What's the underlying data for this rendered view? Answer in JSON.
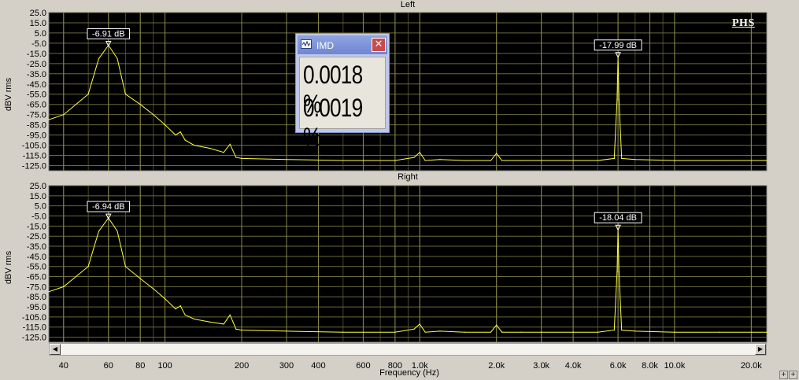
{
  "window": {
    "left_title": "Left",
    "right_title": "Right",
    "y_label": "dBV rms",
    "x_label": "Frequency (Hz)",
    "logo": "PHS"
  },
  "imd_dialog": {
    "title": "IMD",
    "close": "✕",
    "value_left": "0.0018 %",
    "value_right": "0.0019 %"
  },
  "scrollbar": {
    "left_arrow": "◀",
    "right_arrow": "▶"
  },
  "zoom_buttons": [
    "+",
    "+"
  ],
  "chart_data": [
    {
      "type": "line",
      "title": "Left",
      "ylabel": "dBV rms",
      "xlabel": "Frequency (Hz)",
      "xscale": "log",
      "xlim": [
        35,
        23000
      ],
      "ylim": [
        -130,
        25
      ],
      "yticks": [
        25,
        15,
        5,
        -5,
        -15,
        -25,
        -35,
        -45,
        -55,
        -65,
        -75,
        -85,
        -95,
        -105,
        -115,
        -125
      ],
      "xticks": [
        40,
        60,
        80,
        100,
        200,
        300,
        400,
        600,
        800,
        1000,
        2000,
        3000,
        4000,
        6000,
        8000,
        10000,
        20000
      ],
      "xtick_labels": [
        "40",
        "60",
        "80",
        "100",
        "200",
        "300",
        "400",
        "600",
        "800",
        "1.0k",
        "2.0k",
        "3.0k",
        "4.0k",
        "6.0k",
        "8.0k",
        "10.0k",
        "20.0k"
      ],
      "grid": true,
      "series": [
        {
          "color": "#ffff40",
          "x": [
            35,
            40,
            50,
            55,
            60,
            65,
            70,
            80,
            90,
            100,
            110,
            115,
            120,
            130,
            150,
            170,
            180,
            190,
            200,
            300,
            500,
            800,
            950,
            1000,
            1050,
            1200,
            1500,
            1900,
            2000,
            2100,
            2500,
            3000,
            4000,
            5000,
            5800,
            5950,
            6000,
            6050,
            6200,
            7000,
            10000,
            15000,
            23000
          ],
          "y": [
            -80,
            -75,
            -55,
            -20,
            -7,
            -20,
            -55,
            -65,
            -75,
            -85,
            -95,
            -92,
            -100,
            -105,
            -108,
            -112,
            -104,
            -117,
            -118,
            -119,
            -120,
            -120,
            -117,
            -112,
            -120,
            -119,
            -120,
            -120,
            -113,
            -120,
            -120,
            -120,
            -120,
            -120,
            -118,
            -60,
            -18,
            -60,
            -118,
            -119,
            -120,
            -120,
            -120
          ]
        }
      ],
      "annotations": [
        {
          "text": "-6.91 dB",
          "x": 60,
          "y": -7
        },
        {
          "text": "-17.99 dB",
          "x": 6000,
          "y": -18
        }
      ]
    },
    {
      "type": "line",
      "title": "Right",
      "ylabel": "dBV rms",
      "xlabel": "Frequency (Hz)",
      "xscale": "log",
      "xlim": [
        35,
        23000
      ],
      "ylim": [
        -130,
        25
      ],
      "yticks": [
        25,
        15,
        5,
        -5,
        -15,
        -25,
        -35,
        -45,
        -55,
        -65,
        -75,
        -85,
        -95,
        -105,
        -115,
        -125
      ],
      "xticks": [
        40,
        60,
        80,
        100,
        200,
        300,
        400,
        600,
        800,
        1000,
        2000,
        3000,
        4000,
        6000,
        8000,
        10000,
        20000
      ],
      "xtick_labels": [
        "40",
        "60",
        "80",
        "100",
        "200",
        "300",
        "400",
        "600",
        "800",
        "1.0k",
        "2.0k",
        "3.0k",
        "4.0k",
        "6.0k",
        "8.0k",
        "10.0k",
        "20.0k"
      ],
      "grid": true,
      "series": [
        {
          "color": "#ffff40",
          "x": [
            35,
            40,
            50,
            55,
            60,
            65,
            70,
            80,
            90,
            100,
            110,
            115,
            120,
            130,
            150,
            170,
            180,
            190,
            200,
            300,
            500,
            800,
            950,
            1000,
            1050,
            1200,
            1500,
            1900,
            2000,
            2100,
            2500,
            3000,
            4000,
            5000,
            5800,
            5950,
            6000,
            6050,
            6200,
            7000,
            10000,
            15000,
            23000
          ],
          "y": [
            -80,
            -75,
            -55,
            -20,
            -7,
            -20,
            -55,
            -67,
            -77,
            -87,
            -97,
            -94,
            -103,
            -107,
            -110,
            -112,
            -103,
            -117,
            -118,
            -119,
            -120,
            -120,
            -117,
            -112,
            -120,
            -119,
            -120,
            -120,
            -113,
            -120,
            -120,
            -120,
            -120,
            -120,
            -118,
            -60,
            -18,
            -60,
            -118,
            -119,
            -120,
            -120,
            -120
          ]
        }
      ],
      "annotations": [
        {
          "text": "-6.94 dB",
          "x": 60,
          "y": -7
        },
        {
          "text": "-18.04 dB",
          "x": 6000,
          "y": -18
        }
      ]
    }
  ]
}
